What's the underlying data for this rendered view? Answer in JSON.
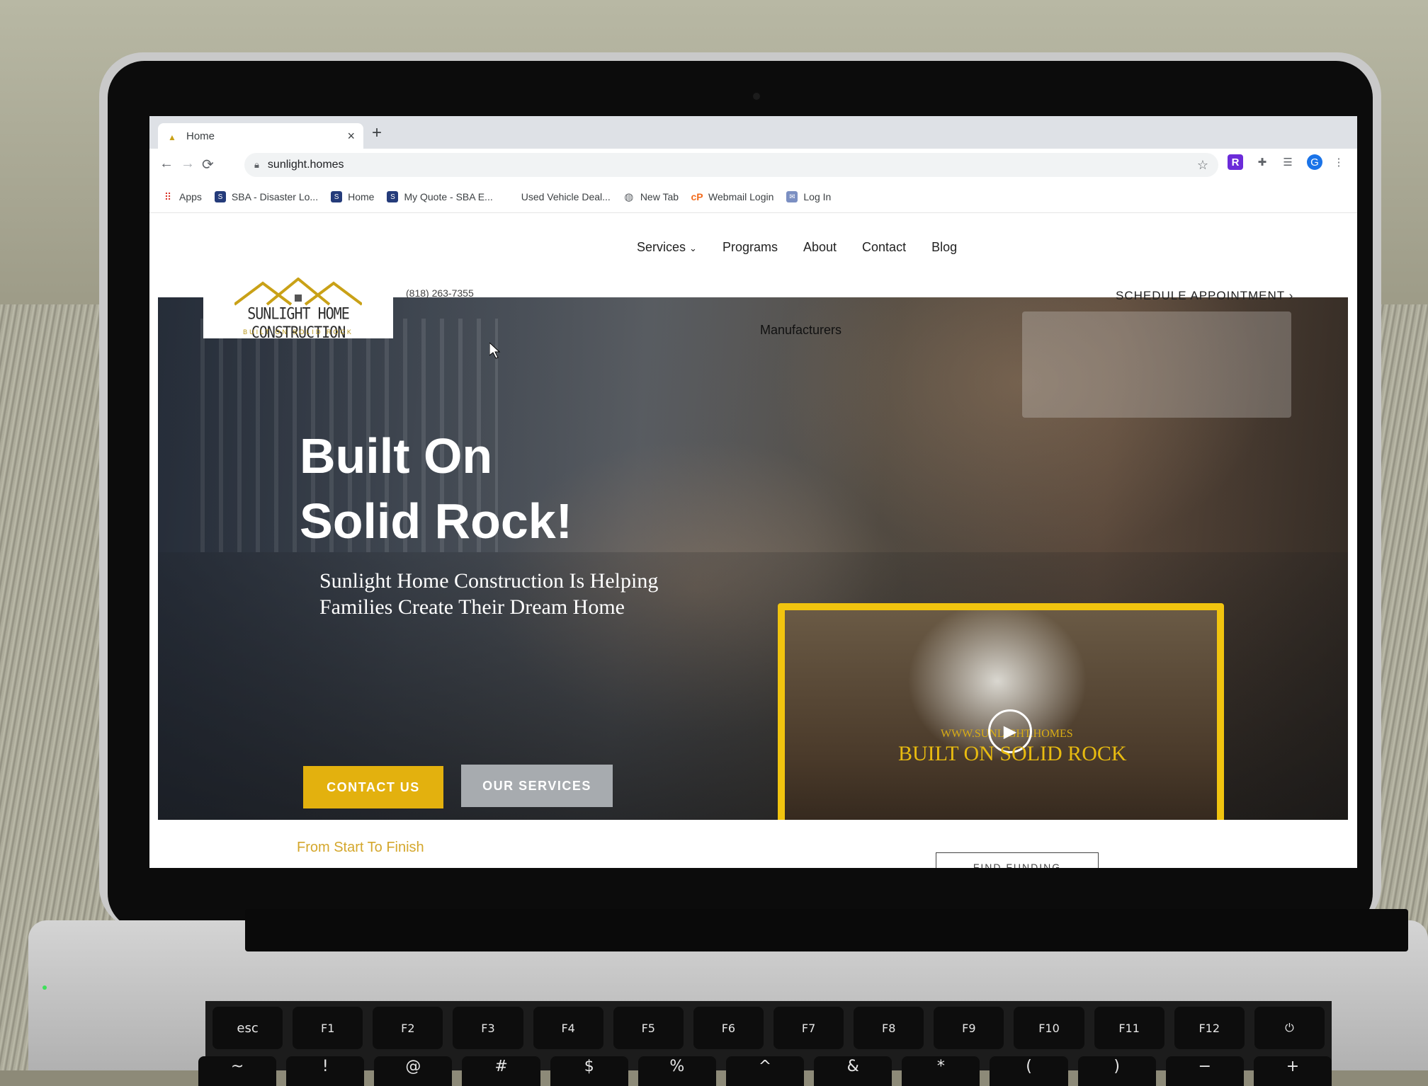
{
  "browser": {
    "tab_title": "Home",
    "new_tab_symbol": "+",
    "close_symbol": "×",
    "url": "sunlight.homes",
    "profile_initial": "G"
  },
  "bookmarks": [
    {
      "label": "Apps",
      "icon": "apps-grid-icon"
    },
    {
      "label": "SBA - Disaster Lo...",
      "icon": "sba-icon"
    },
    {
      "label": "Home",
      "icon": "sba-icon"
    },
    {
      "label": "My Quote - SBA E...",
      "icon": "sba-icon"
    },
    {
      "label": "Used Vehicle Deal...",
      "icon": "none"
    },
    {
      "label": "New Tab",
      "icon": "globe-icon"
    },
    {
      "label": "Webmail Login",
      "icon": "cpanel-icon"
    },
    {
      "label": "Log In",
      "icon": "login-icon"
    }
  ],
  "site": {
    "nav": [
      "Services",
      "Programs",
      "About",
      "Contact",
      "Blog"
    ],
    "logo_name": "SUNLIGHT HOME CONSTRUCTION",
    "logo_tag": "BUILT ON SOLID ROCK",
    "phone": "(818) 263-7355",
    "schedule": "SCHEDULE APPOINTMENT",
    "manufacturers": "Manufacturers",
    "headline_line1": "Built On",
    "headline_line2": "Solid Rock!",
    "subhead_line1": "Sunlight Home Construction Is Helping",
    "subhead_line2": "Families Create Their Dream Home",
    "contact_button": "CONTACT US",
    "services_button": "OUR SERVICES",
    "video_small_text": "WWW.SUNLIGHT.HOMES",
    "video_big_text": "BUILT ON SOLID ROCK",
    "from_start": "From Start To Finish",
    "find_funding": "FIND FUNDING"
  },
  "keyboard": {
    "fn_row": [
      "esc",
      "F1",
      "F2",
      "F3",
      "F4",
      "F5",
      "F6",
      "F7",
      "F8",
      "F9",
      "F10",
      "F11",
      "F12",
      "⏻"
    ],
    "num_row": [
      "~",
      "!",
      "@",
      "#",
      "$",
      "%",
      "^",
      "&",
      "*",
      "(",
      ")",
      "−",
      "+"
    ]
  },
  "colors": {
    "accent_gold": "#e3b10e",
    "video_border": "#f1c40f",
    "secondary_button": "#a7abaf",
    "subtitle_gold": "#d4a72c"
  }
}
